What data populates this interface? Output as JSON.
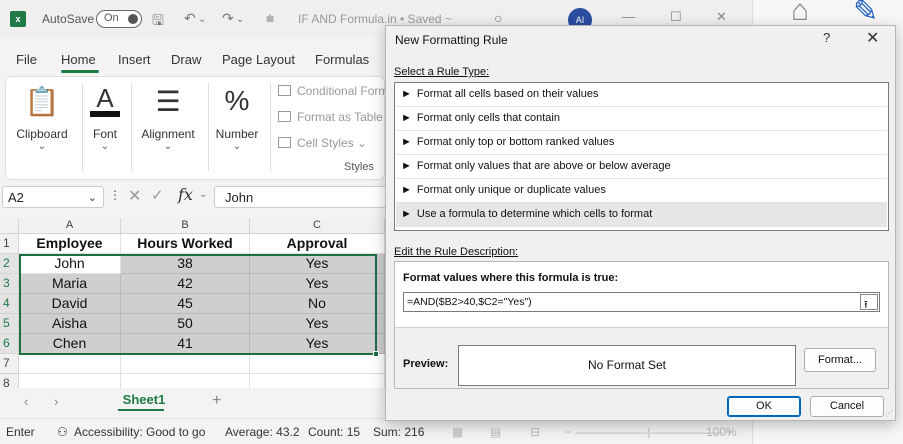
{
  "titlebar": {
    "logo": "x",
    "autosave_label": "AutoSave",
    "autosave_state": "On",
    "file_title": "IF AND Formula.in  •  Saved ~",
    "avatar_initials": "AI"
  },
  "ribbon_tabs": [
    "File",
    "Home",
    "Insert",
    "Draw",
    "Page Layout",
    "Formulas"
  ],
  "ribbon": {
    "groups": [
      {
        "label": "Clipboard",
        "icon": "clipboard-icon"
      },
      {
        "label": "Font",
        "icon": "font-icon"
      },
      {
        "label": "Alignment",
        "icon": "alignment-icon"
      },
      {
        "label": "Number",
        "icon": "percent-icon"
      }
    ],
    "styles_items": [
      "Conditional Form",
      "Format as Table",
      "Cell Styles"
    ],
    "styles_group_label": "Styles"
  },
  "formula_bar": {
    "name_box": "A2",
    "fx_label": "fx",
    "value": "John"
  },
  "grid": {
    "columns": [
      "A",
      "B",
      "C"
    ],
    "rows": [
      "1",
      "2",
      "3",
      "4",
      "5",
      "6",
      "7",
      "8"
    ],
    "header": [
      "Employee",
      "Hours Worked",
      "Approval"
    ],
    "data": [
      [
        "John",
        "38",
        "Yes"
      ],
      [
        "Maria",
        "42",
        "Yes"
      ],
      [
        "David",
        "45",
        "No"
      ],
      [
        "Aisha",
        "50",
        "Yes"
      ],
      [
        "Chen",
        "41",
        "Yes"
      ]
    ]
  },
  "sheet_tabs": {
    "active": "Sheet1",
    "add": "+"
  },
  "statusbar": {
    "mode": "Enter",
    "accessibility": "Accessibility: Good to go",
    "average": "Average: 43.2",
    "count": "Count: 15",
    "sum": "Sum: 216",
    "zoom": "100%"
  },
  "dialog": {
    "title": "New Formatting Rule",
    "help": "?",
    "close": "✕",
    "select_rule_label": "Select a Rule Type:",
    "rule_types": [
      "Format all cells based on their values",
      "Format only cells that contain",
      "Format only top or bottom ranked values",
      "Format only values that are above or below average",
      "Format only unique or duplicate values",
      "Use a formula to determine which cells to format"
    ],
    "selected_rule_index": 5,
    "edit_desc_label": "Edit the Rule Description:",
    "formula_label": "Format values where this formula is true:",
    "formula_value": "=AND($B2>40,$C2=\"Yes\")",
    "preview_label": "Preview:",
    "preview_text": "No Format Set",
    "format_button": "Format...",
    "ok_button": "OK",
    "cancel_button": "Cancel"
  },
  "colors": {
    "excel_green": "#1f7a45",
    "selection_border": "#1f6e43",
    "cell_shade": "#cfcfcf",
    "ok_border": "#0067c0"
  }
}
